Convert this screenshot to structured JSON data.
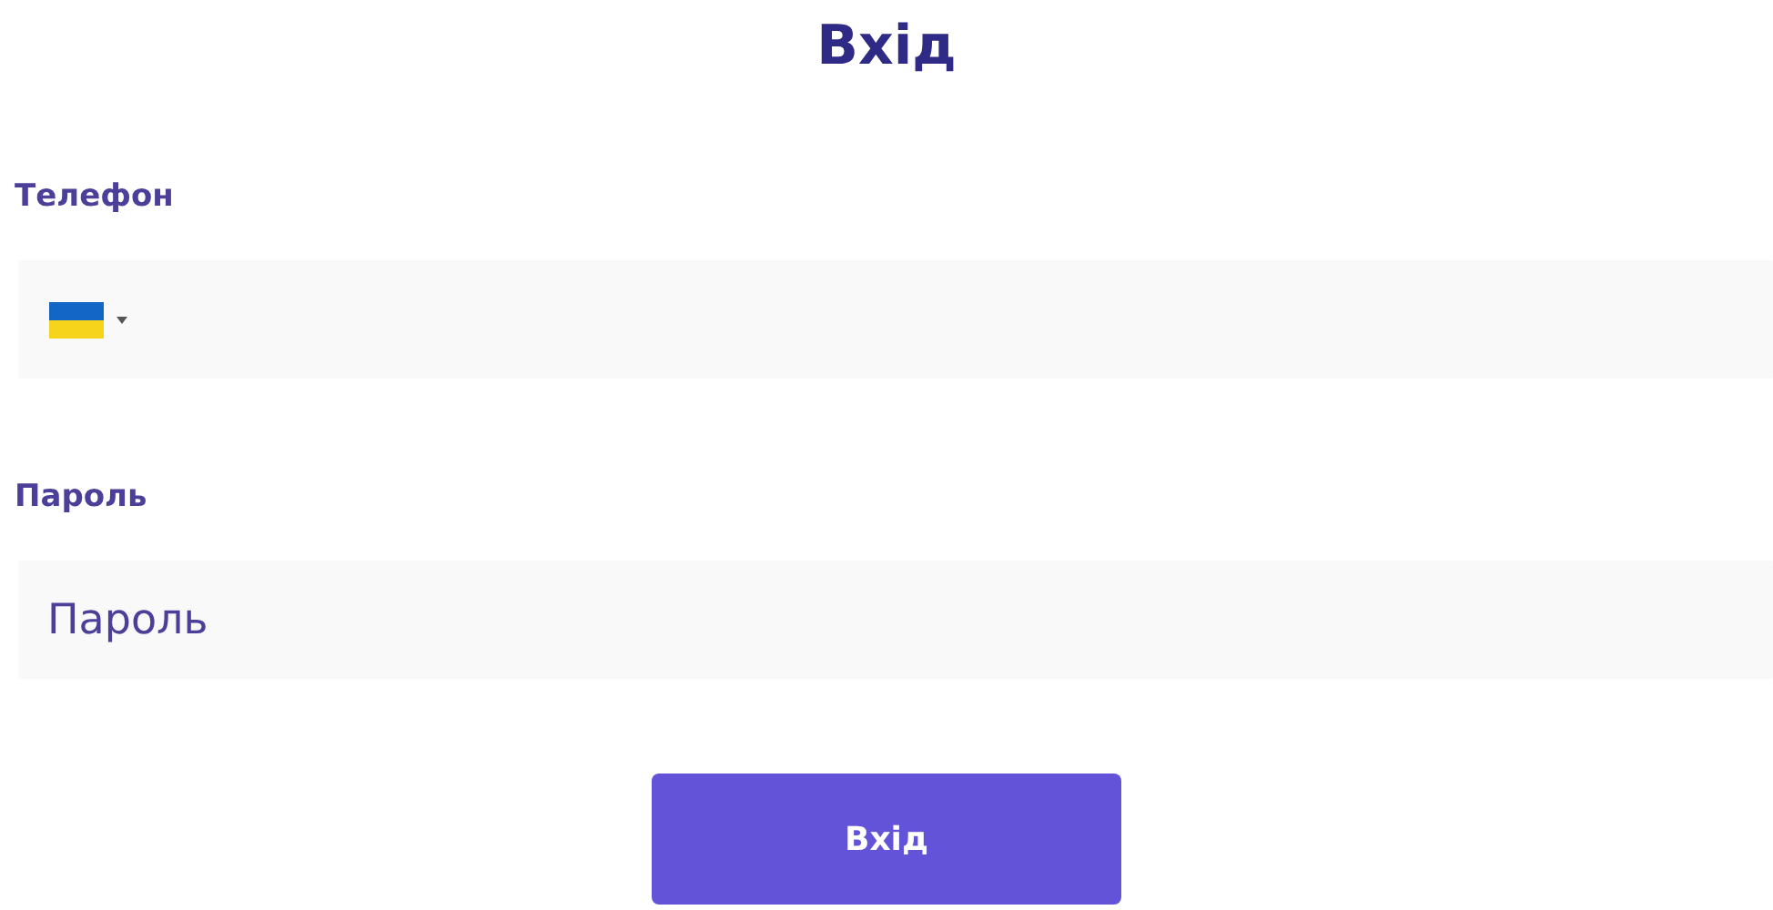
{
  "title": "Вхід",
  "phone": {
    "label": "Телефон"
  },
  "password": {
    "label": "Пароль",
    "placeholder": "Пароль"
  },
  "submit": {
    "label": "Вхід"
  }
}
